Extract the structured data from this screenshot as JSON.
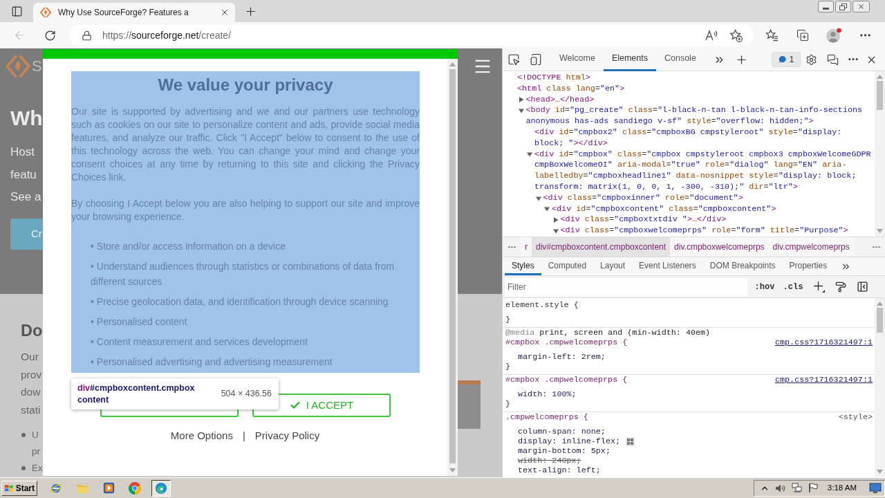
{
  "browser": {
    "tab": {
      "title": "Why Use SourceForge? Features a",
      "selected": true
    },
    "back_disabled": true,
    "address": {
      "scheme": "https://",
      "host": "sourceforge.net",
      "path": "/create/"
    }
  },
  "page": {
    "hero": {
      "logo_text": "S",
      "heading": "Wh",
      "lines": [
        "Host",
        "featu",
        "See a"
      ],
      "button": "Cr"
    },
    "section": {
      "heading": "Do",
      "lines": [
        "Our",
        "prov",
        "dow",
        "stati"
      ],
      "bullets": [
        {
          "lines": [
            "U",
            "pr"
          ]
        },
        {
          "lines": [
            "Ex"
          ]
        }
      ]
    }
  },
  "consent_dialog": {
    "inspect_highlight": true,
    "title": "We value your privacy",
    "paragraphs": [
      "Our site is supported by advertising and we and our partners use technology such as cookies on our site to personalize content and ads, provide social media features, and analyze our traffic. Click \"I Accept\" below to consent to the use of this technology across the web. You can change your mind and change your consent choices at any time by returning to this site and clicking the Privacy Choices link.",
      "By choosing I Accept below you are also helping to support our site and improve your browsing experience."
    ],
    "purposes": [
      "• Store and/or access information on a device",
      "• Understand audiences through statistics or combinations of data from different sources",
      "• Precise geolocation data, and identification through device scanning",
      "• Personalised content",
      "• Content measurement and services development",
      "• Personalised advertising and advertising measurement"
    ],
    "buttons": [
      {
        "kind": "outline"
      },
      {
        "kind": "accept",
        "label": "I ACCEPT"
      }
    ],
    "links": [
      "More Options",
      "Privacy Policy"
    ],
    "separator": "|",
    "inspect_tooltip": {
      "tag": "div",
      "selector": "#cmpboxcontent.cmpboxcontent",
      "size": "504 × 436.56"
    }
  },
  "devtools": {
    "tabs": [
      {
        "label": "Welcome",
        "selected": false
      },
      {
        "label": "Elements",
        "selected": true
      },
      {
        "label": "Console",
        "selected": false
      }
    ],
    "issues_count": "1",
    "dom_tree": [
      {
        "text": "<!DOCTYPE html>"
      },
      {
        "text": "<html class lang=\"en\">",
        "children": [
          {
            "text": "<head>…</head>",
            "expanded": false
          },
          {
            "text": "<body id=\"pg_create\" class=\"l-black-n-tan l-black-n-tan-info-sections anonymous has-ads sandiego v-sf\" style=\"overflow: hidden;\">",
            "expanded": true,
            "children": [
              {
                "text": "<div id=\"cmpbox2\" class=\"cmpboxBG cmpstyleroot\" style=\"display: block; \"></div>"
              },
              {
                "text": "<div id=\"cmpbox\" class=\"cmpbox cmpstyleroot cmpbox3 cmpboxWelcomeGDPR cmpBoxWelcomeOI\" aria-modal=\"true\" role=\"dialog\" lang=\"EN\" aria-labelledby=\"cmpboxheadline1\" data-nosnippet style=\"display: block; transform: matrix(1, 0, 0, 1, -300, -310);\" dir=\"ltr\">",
                "expanded": true,
                "children": [
                  {
                    "text": "<div class=\"cmpboxinner\" role=\"document\">",
                    "expanded": true,
                    "children": [
                      {
                        "text": "<div id=\"cmpboxcontent\" class=\"cmpboxcontent\">",
                        "expanded": true,
                        "children": [
                          {
                            "text": "<div class=\"cmpboxtxtdiv \">…</div>",
                            "expanded": false
                          },
                          {
                            "text": "<div class=\"cmpboxwelcomeprps\" role=\"form\" title=\"Purpose\">",
                            "expanded": true
                          }
                        ]
                      }
                    ]
                  }
                ]
              }
            ]
          }
        ]
      }
    ],
    "breadcrumbs": [
      {
        "label": "r",
        "selected": false
      },
      {
        "label": "div#cmpboxcontent.cmpboxcontent",
        "selected": true
      },
      {
        "label": "div.cmpboxwelcomeprps",
        "selected": false
      },
      {
        "label": "div.cmpwelcomeprps",
        "selected": false
      }
    ],
    "sidebar_tabs": [
      {
        "label": "Styles",
        "selected": true
      },
      {
        "label": "Computed",
        "selected": false
      },
      {
        "label": "Layout",
        "selected": false
      },
      {
        "label": "Event Listeners",
        "selected": false
      },
      {
        "label": "DOM Breakpoints",
        "selected": false
      },
      {
        "label": "Properties",
        "selected": false
      }
    ],
    "filter": {
      "placeholder": "Filter"
    },
    "filter_buttons": [
      ":hov",
      ".cls"
    ],
    "style_rules": [
      {
        "kind": "inline",
        "selector": "element.style {",
        "close": "}"
      },
      {
        "kind": "css",
        "media": "@media print, screen and (min-width: 40em)",
        "selector": "#cmpbox .cmpwelcomeprps {",
        "source": {
          "label": "cmp.css?1716321497:1",
          "link": true
        },
        "declarations": [
          {
            "kind": "plain",
            "text": "margin-left: 2rem;",
            "overridden": false
          }
        ],
        "close": "}"
      },
      {
        "kind": "css",
        "selector": "#cmpbox .cmpwelcomeprps {",
        "source": {
          "label": "cmp.css?1716321497:1",
          "link": true
        },
        "declarations": [
          {
            "kind": "plain",
            "text": "width: 100%;",
            "overridden": false
          }
        ],
        "close": "}"
      },
      {
        "kind": "css",
        "selector": ".cmpwelcomeprps {",
        "source": {
          "label": "<style>",
          "link": false
        },
        "declarations": [
          {
            "kind": "plain",
            "text": "column-span: none;",
            "overridden": false
          },
          {
            "kind": "flex",
            "text": "display: inline-flex;",
            "overridden": false
          },
          {
            "kind": "plain",
            "text": "margin-bottom: 5px;",
            "overridden": false
          },
          {
            "kind": "plain",
            "text": "width: 240px;",
            "overridden": true
          },
          {
            "kind": "plain",
            "text": "text-align: left;",
            "overridden": false
          }
        ]
      }
    ]
  },
  "taskbar": {
    "start": "Start",
    "apps": [
      {
        "kind": "globe",
        "selected": false
      },
      {
        "kind": "folder",
        "selected": false
      },
      {
        "kind": "media",
        "selected": false
      },
      {
        "kind": "tricolor",
        "selected": false
      },
      {
        "kind": "swirl",
        "selected": true
      }
    ],
    "time": "3:18 AM"
  }
}
